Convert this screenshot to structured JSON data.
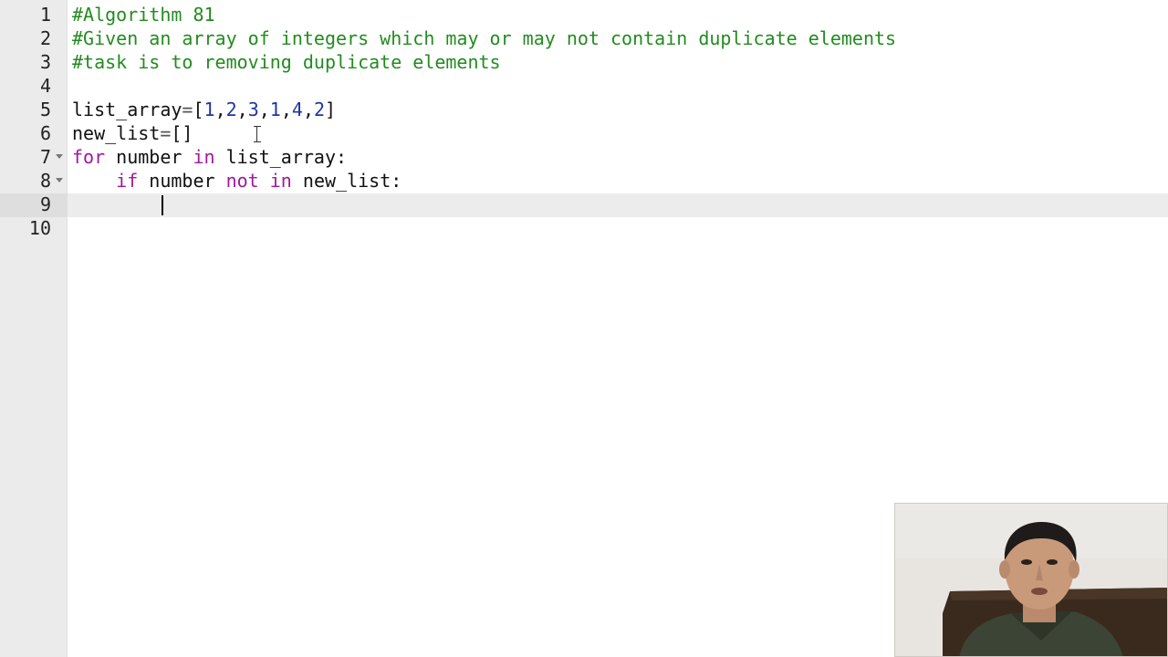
{
  "editor": {
    "line_numbers": [
      "1",
      "2",
      "3",
      "4",
      "5",
      "6",
      "7",
      "8",
      "9",
      "10"
    ],
    "lines": [
      [
        {
          "t": "#Algorithm 81",
          "c": "comment"
        }
      ],
      [
        {
          "t": "#Given an array of integers which may or may not contain duplicate elements",
          "c": "comment"
        }
      ],
      [
        {
          "t": "#task is to removing duplicate elements",
          "c": "comment"
        }
      ],
      [],
      [
        {
          "t": "list_array",
          "c": "plain"
        },
        {
          "t": "=",
          "c": "op"
        },
        {
          "t": "[",
          "c": "plain"
        },
        {
          "t": "1",
          "c": "number"
        },
        {
          "t": ",",
          "c": "plain"
        },
        {
          "t": "2",
          "c": "number"
        },
        {
          "t": ",",
          "c": "plain"
        },
        {
          "t": "3",
          "c": "number"
        },
        {
          "t": ",",
          "c": "plain"
        },
        {
          "t": "1",
          "c": "number"
        },
        {
          "t": ",",
          "c": "plain"
        },
        {
          "t": "4",
          "c": "number"
        },
        {
          "t": ",",
          "c": "plain"
        },
        {
          "t": "2",
          "c": "number"
        },
        {
          "t": "]",
          "c": "plain"
        }
      ],
      [
        {
          "t": "new_list",
          "c": "plain"
        },
        {
          "t": "=",
          "c": "op"
        },
        {
          "t": "[]",
          "c": "plain"
        }
      ],
      [
        {
          "t": "for",
          "c": "keyword"
        },
        {
          "t": " number ",
          "c": "plain"
        },
        {
          "t": "in",
          "c": "keyword"
        },
        {
          "t": " list_array:",
          "c": "plain"
        }
      ],
      [
        {
          "t": "    ",
          "c": "plain"
        },
        {
          "t": "if",
          "c": "keyword"
        },
        {
          "t": " number ",
          "c": "plain"
        },
        {
          "t": "not",
          "c": "keyword"
        },
        {
          "t": " ",
          "c": "plain"
        },
        {
          "t": "in",
          "c": "keyword"
        },
        {
          "t": " new_list:",
          "c": "plain"
        }
      ],
      [
        {
          "t": "        ",
          "c": "plain"
        }
      ],
      []
    ],
    "fold_lines": [
      7,
      8
    ],
    "active_line": 9,
    "colors": {
      "comment": "#238b1f",
      "keyword": "#a2189a",
      "number": "#1e35a6",
      "plain": "#111111",
      "gutter_bg": "#ebebeb",
      "active_line_bg": "#ececec"
    }
  },
  "webcam": {
    "icon": "presenter-webcam"
  }
}
